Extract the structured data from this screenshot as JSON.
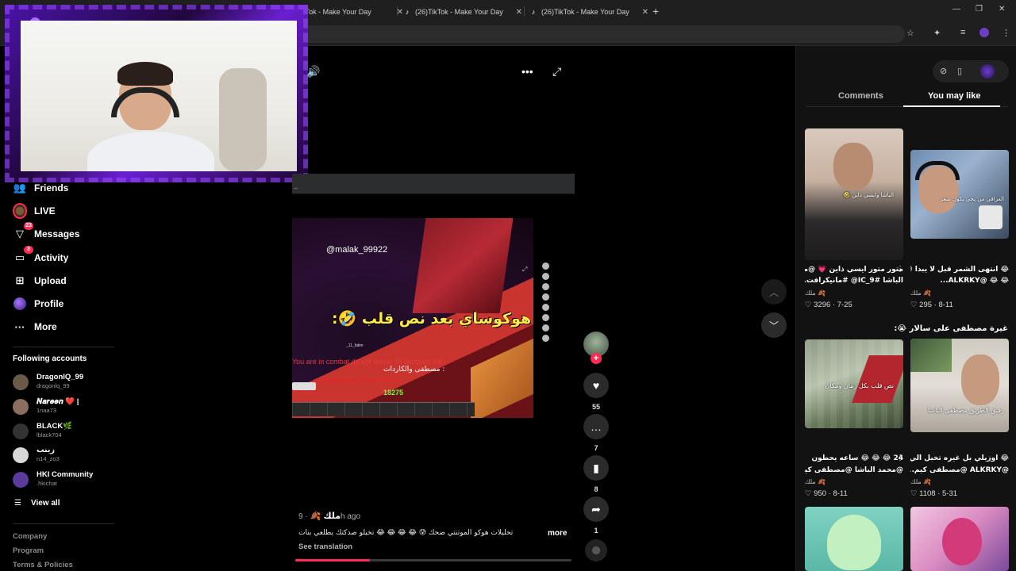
{
  "browser": {
    "tabs": [
      {
        "title": "TikTok - Make Your Day"
      },
      {
        "title": "(26)TikTok - Make Your Day"
      },
      {
        "title": "(26)TikTok - Make Your Day"
      }
    ],
    "new_tab_symbol": "+",
    "tab_close_symbol": "✕"
  },
  "sidebar": {
    "nav": [
      {
        "label": "Friends",
        "icon": "friends-icon"
      },
      {
        "label": "LIVE",
        "icon": "live-avatar"
      },
      {
        "label": "Messages",
        "icon": "messages-icon",
        "badge": "23"
      },
      {
        "label": "Activity",
        "icon": "activity-icon",
        "badge": "3"
      },
      {
        "label": "Upload",
        "icon": "upload-icon"
      },
      {
        "label": "Profile",
        "icon": "profile-icon"
      },
      {
        "label": "More",
        "icon": "more-dots-icon"
      }
    ],
    "following_title": "Following accounts",
    "accounts": [
      {
        "name": "DragonIQ_99",
        "handle": "dragonlq_99",
        "color": "#6b5a4a"
      },
      {
        "name": "𝑵𝒂𝒓𝒆𝒆𝒏 ❤️ |",
        "handle": "1naa73",
        "color": "#8a6f60"
      },
      {
        "name": "BLACK🌿",
        "handle": "lblack704",
        "color": "#333333"
      },
      {
        "name": "زينب",
        "handle": "n14_zo3",
        "color": "#d8d8d8"
      },
      {
        "name": "HKI Community",
        "handle": ".hkichat",
        "color": "#5a3a9a"
      }
    ],
    "view_all": "View all",
    "footer": [
      "Company",
      "Program",
      "Terms & Policies"
    ]
  },
  "video": {
    "mention": "@malak_99922",
    "caption_overlay": "هوكوساي بعد نص قلب 🤣:",
    "small_handle": "_11_fatim",
    "combat_text": "You are in combat do not leave! 15 seconds left",
    "overlay_small": "مصطفى والكاردات :",
    "xp": "18275",
    "author": "ملك 🍂",
    "time_ago": "· 9h ago",
    "description": "تحليلات هوكو الموتنتي ضحك 😰 😂 😂 😂 😂 تخيلو صدكتك يطلعي بنات",
    "more": "more",
    "see_translation": "See translation",
    "progress": 0.27,
    "actions": {
      "likes": "55",
      "comments": "7",
      "bookmarks": "8",
      "shares": "1"
    }
  },
  "right_panel": {
    "tabs": [
      {
        "label": "Comments"
      },
      {
        "label": "You may like"
      }
    ],
    "active_tab": "You may like",
    "cards": [
      {
        "caption1": "متور متور ايسي ذاين 💗 @محمد",
        "caption2": "الباشا #IC_9@ #مانيكرافت...",
        "author": "ملك 🍂",
        "stats": "♡ 3296 · 7-25",
        "thumb_text": "الباشا وايسي ذاين 🤣"
      },
      {
        "caption1": "😂 انتهى الشمر قبل لا يبدا 😰",
        "caption2": "😂 😂 @ALKRKY...",
        "author": "ملك 🍂",
        "stats": "♡ 295 · 8-11",
        "thumb_text": "العراقي من يجي يكول شعر"
      },
      {
        "caption1": "24 😂 😂 😂 ساعه يحطون",
        "caption2": "@محمد الباشا @مصطفى كيم...",
        "author": "ملك 🍂",
        "stats": "♡ 950 · 8-11",
        "thumb_text": "نص قلب بكل زمان ومكان"
      },
      {
        "caption1": "😂 اوزيلي بل غيره تخبل الي بينهم",
        "caption2": "@ALKRKY @مصطفى كيم...",
        "author": "ملك 🍂",
        "stats": "♡ 1108 · 5-31",
        "thumb_text": "رفيق الطريق مصطفى الباشا",
        "above_caption": "غيرة مصطفى على سالار 😭:"
      }
    ]
  }
}
